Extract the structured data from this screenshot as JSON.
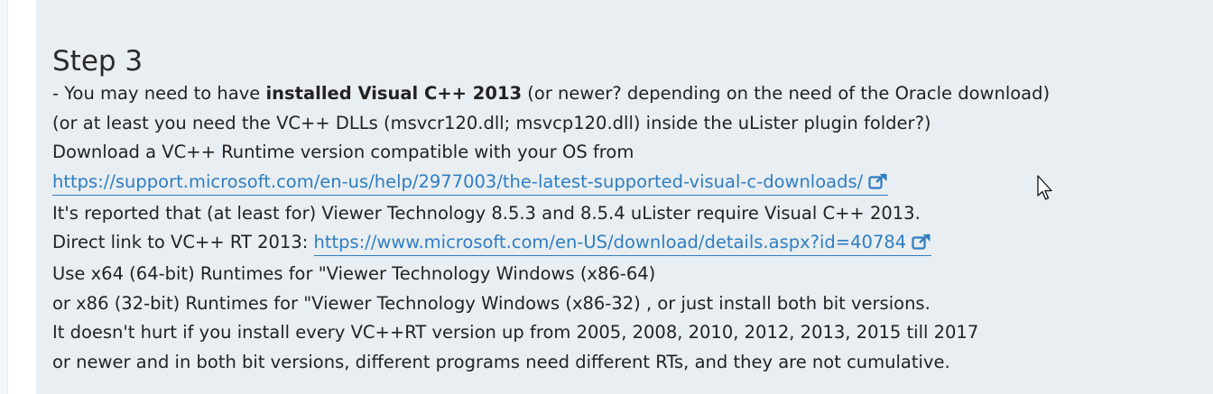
{
  "step": {
    "title": "Step 3",
    "line1": {
      "prefix": "- You may need to have ",
      "bold": "installed Visual C++ 2013",
      "suffix": " (or newer? depending on the need of the Oracle download)"
    },
    "line2": "(or at least you need the VC++ DLLs (msvcr120.dll; msvcp120.dll) inside the uLister plugin folder?)",
    "line3": "Download a VC++ Runtime version compatible with your OS from",
    "link1": "https://support.microsoft.com/en-us/help/2977003/the-latest-supported-visual-c-downloads/",
    "line4": "It's reported that (at least for) Viewer Technology 8.5.3 and 8.5.4 uLister require Visual C++ 2013.",
    "line5_prefix": "Direct link to VC++ RT 2013: ",
    "link2": "https://www.microsoft.com/en-US/download/details.aspx?id=40784",
    "line6": "Use x64 (64-bit) Runtimes for \"Viewer Technology Windows (x86-64)",
    "line7": "or x86 (32-bit) Runtimes for \"Viewer Technology Windows (x86-32) , or just install both bit versions.",
    "line8": "It doesn't hurt if you install every VC++RT version up from 2005, 2008, 2010, 2012, 2013, 2015 till 2017",
    "line9": "or newer and in both bit versions, different programs need different RTs, and they are not cumulative."
  },
  "colors": {
    "panel_background": "#e8eef2",
    "link": "#2f7dc3",
    "text": "#222222"
  },
  "icons": {
    "external_link": "external-link-icon",
    "cursor": "mouse-pointer-icon"
  }
}
